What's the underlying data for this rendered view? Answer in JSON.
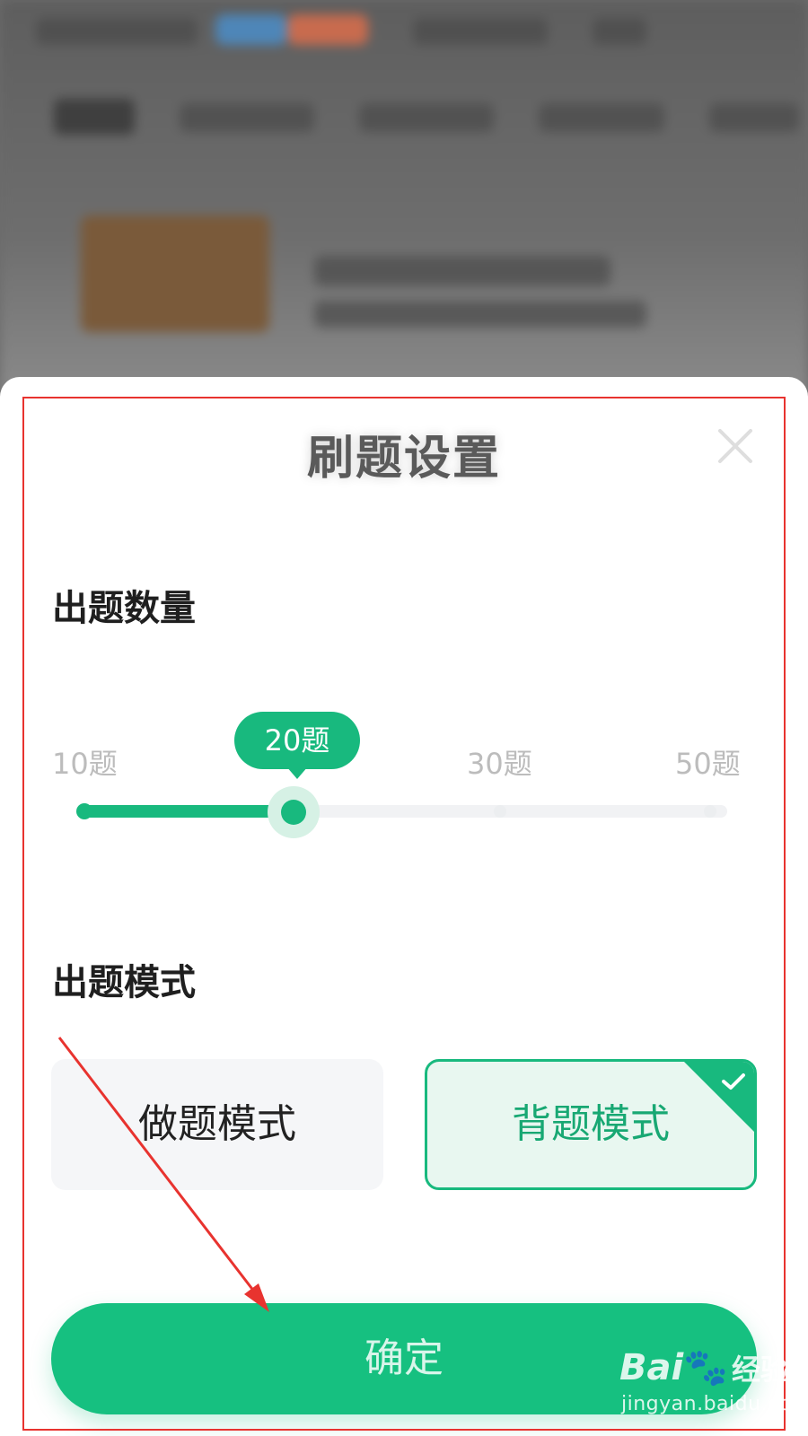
{
  "sheet": {
    "title": "刷题设置",
    "close_icon": "close-icon"
  },
  "question_count": {
    "label": "出题数量",
    "ticks": [
      "10题",
      "30题",
      "50题"
    ],
    "selected_label": "20题",
    "selected_fraction": 0.33
  },
  "question_mode": {
    "label": "出题模式",
    "options": [
      {
        "label": "做题模式",
        "selected": false
      },
      {
        "label": "背题模式",
        "selected": true
      }
    ]
  },
  "confirm_button": {
    "label": "确定"
  },
  "watermark": {
    "brand": "Bai",
    "brand_suffix": "经验",
    "url": "jingyan.baidu.com"
  },
  "colors": {
    "accent": "#18b97e",
    "annotation_red": "#e8332f"
  }
}
